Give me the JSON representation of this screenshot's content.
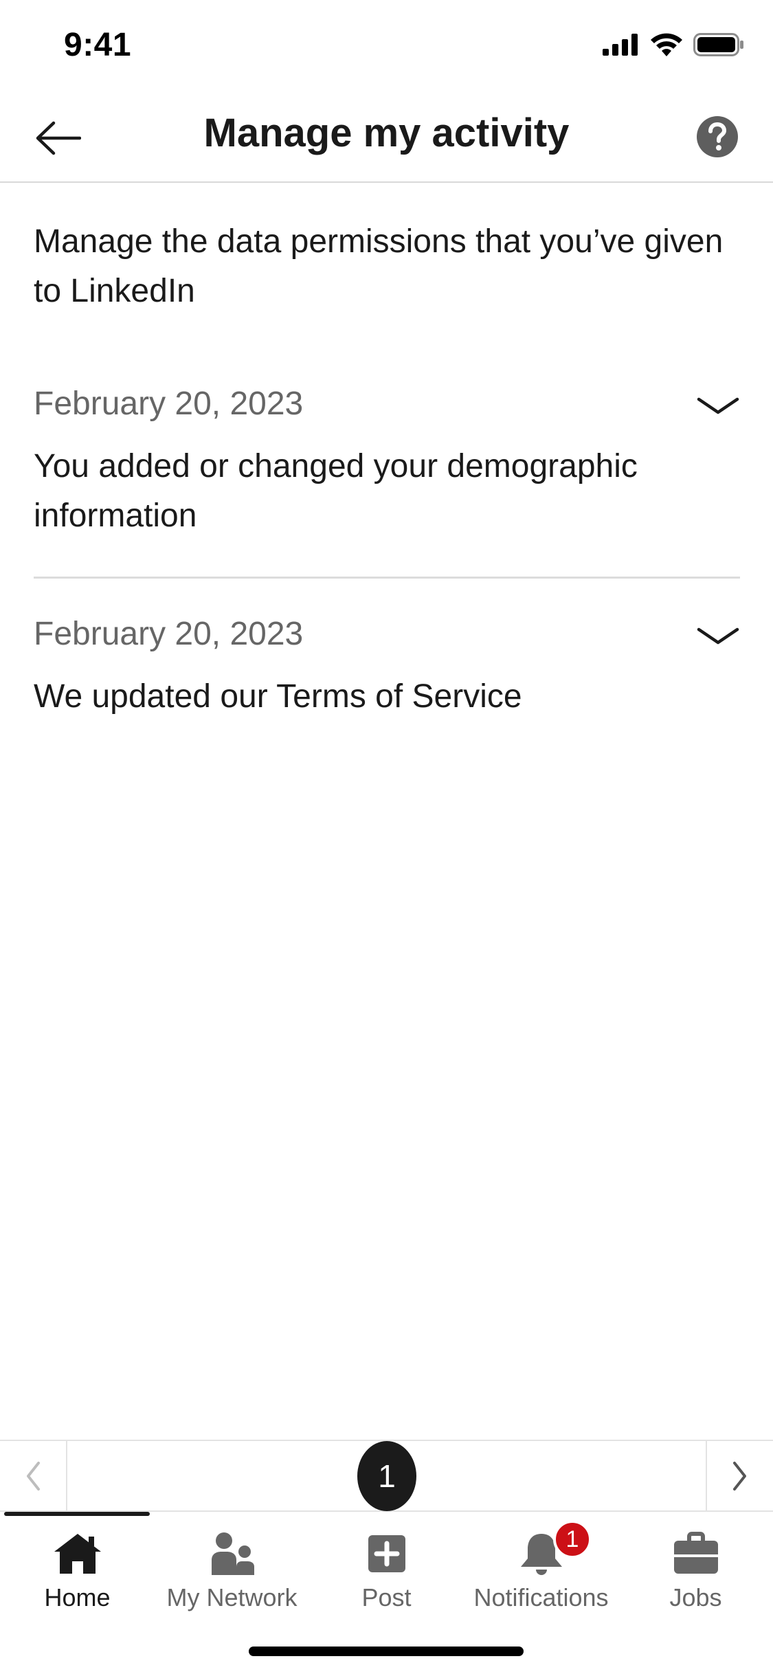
{
  "status_bar": {
    "time": "9:41"
  },
  "header": {
    "title": "Manage my activity"
  },
  "intro": "Manage the data permissions that you’ve given to LinkedIn",
  "activities": [
    {
      "date": "February 20, 2023",
      "description": "You added or changed your demographic information"
    },
    {
      "date": "February 20, 2023",
      "description": "We updated our Terms of Service"
    }
  ],
  "pager": {
    "current": "1"
  },
  "tabbar": {
    "tabs": [
      {
        "label": "Home",
        "icon": "home-icon",
        "active": true
      },
      {
        "label": "My Network",
        "icon": "network-icon"
      },
      {
        "label": "Post",
        "icon": "post-icon"
      },
      {
        "label": "Notifications",
        "icon": "bell-icon",
        "badge": "1"
      },
      {
        "label": "Jobs",
        "icon": "briefcase-icon"
      }
    ]
  },
  "colors": {
    "text_primary": "#1a1a1a",
    "text_secondary": "#666666",
    "badge": "#cc1016",
    "divider": "#dcdcdc"
  }
}
